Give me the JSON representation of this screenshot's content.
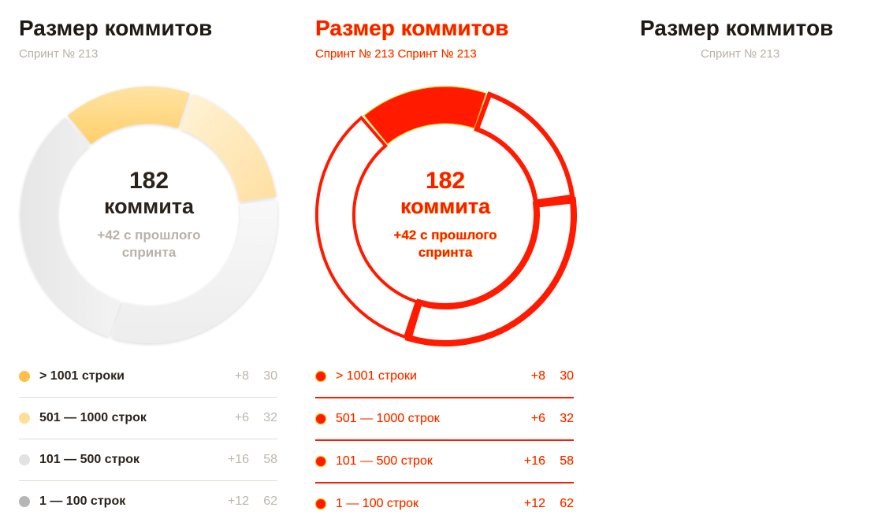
{
  "panels": [
    {
      "title": "Размер коммитов",
      "subtitle": "Спринт № 213",
      "donut": {
        "count": "182",
        "unit": "коммита",
        "delta": "+42 с прошлого\nспринта"
      }
    },
    {
      "title": "Размер коммитов",
      "subtitle": "Спринт № 213  Спринт № 213",
      "donut": {
        "count": "182",
        "unit": "коммита",
        "delta": "+42 с прошлого\nспринта"
      }
    },
    {
      "title": "Размер коммитов",
      "subtitle": "Спринт № 213"
    }
  ],
  "legend": [
    {
      "label": "> 1001 строки",
      "delta": "+8",
      "value": "30",
      "color": "#ffbf4a"
    },
    {
      "label": "501 — 1000 строк",
      "delta": "+6",
      "value": "32",
      "color": "#ffdd9a"
    },
    {
      "label": "101 — 500 строк",
      "delta": "+16",
      "value": "58",
      "color": "#e2e2e2"
    },
    {
      "label": "1 — 100 строк",
      "delta": "+12",
      "value": "62",
      "color": "#b6b6b6"
    }
  ],
  "chart_data": {
    "type": "pie",
    "categories": [
      "> 1001 строки",
      "501 — 1000 строк",
      "101 — 500 строк",
      "1 — 100 строк"
    ],
    "values": [
      30,
      32,
      58,
      62
    ],
    "title": "Размер коммитов"
  },
  "colors": {
    "accent_dark_yellow": "#ffbf4a",
    "accent_light_yellow": "#ffdd9a",
    "light_gray": "#e2e2e2",
    "mid_gray": "#b6b6b6",
    "diff_red": "#ff1a00",
    "diff_yellow": "#ffd000"
  }
}
